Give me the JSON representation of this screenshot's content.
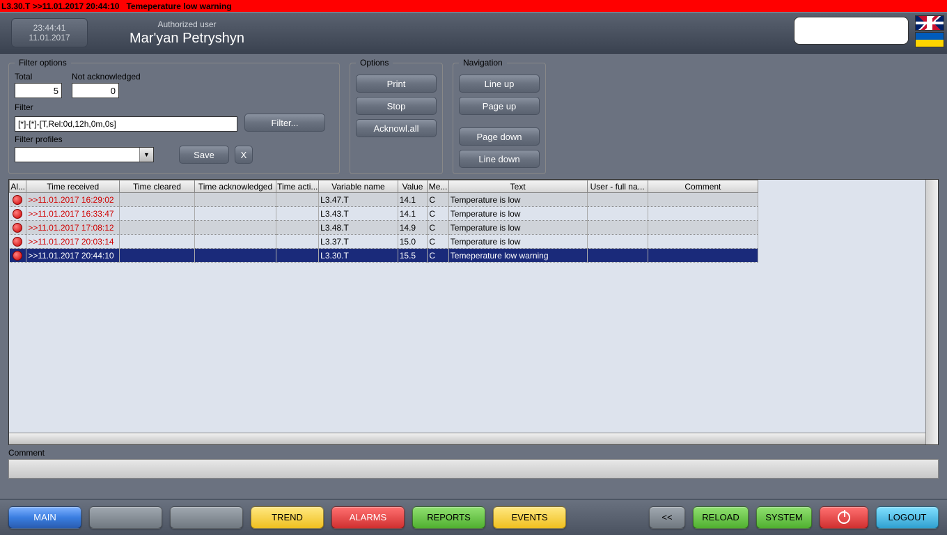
{
  "top_alarm": {
    "variable": "L3.30.T",
    "ts": ">>11.01.2017 20:44:10",
    "msg": "Temeperature low warning"
  },
  "clock": {
    "time": "23:44:41",
    "date": "11.01.2017"
  },
  "user": {
    "label": "Authorized user",
    "name": "Mar'yan Petryshyn"
  },
  "filter_options": {
    "legend": "Filter options",
    "total_label": "Total",
    "total": "5",
    "nack_label": "Not acknowledged",
    "nack": "0",
    "filter_label": "Filter",
    "filter_value": "[*]-[*]-[T,Rel:0d,12h,0m,0s]",
    "filter_btn": "Filter...",
    "profiles_label": "Filter profiles",
    "save_btn": "Save",
    "clear_btn": "X"
  },
  "options": {
    "legend": "Options",
    "print": "Print",
    "stop": "Stop",
    "ack": "Acknowl.all"
  },
  "navigation": {
    "legend": "Navigation",
    "lu": "Line up",
    "pu": "Page up",
    "pd": "Page down",
    "ld": "Line down"
  },
  "table": {
    "headers": {
      "al": "Al...",
      "tr": "Time received",
      "tc": "Time cleared",
      "ta": "Time acknowledged",
      "tact": "Time acti...",
      "vn": "Variable name",
      "val": "Value",
      "me": "Me...",
      "text": "Text",
      "user": "User - full na...",
      "cm": "Comment"
    },
    "rows": [
      {
        "tr": ">>11.01.2017 16:29:02",
        "vn": "L3.47.T",
        "val": "14.1",
        "me": "C",
        "text": "Temperature is low",
        "sel": false,
        "unack": true
      },
      {
        "tr": ">>11.01.2017 16:33:47",
        "vn": "L3.43.T",
        "val": "14.1",
        "me": "C",
        "text": "Temperature is low",
        "sel": false,
        "unack": true
      },
      {
        "tr": ">>11.01.2017 17:08:12",
        "vn": "L3.48.T",
        "val": "14.9",
        "me": "C",
        "text": "Temperature is low",
        "sel": false,
        "unack": true
      },
      {
        "tr": ">>11.01.2017 20:03:14",
        "vn": "L3.37.T",
        "val": "15.0",
        "me": "C",
        "text": "Temperature is low",
        "sel": false,
        "unack": true
      },
      {
        "tr": ">>11.01.2017 20:44:10",
        "vn": "L3.30.T",
        "val": "15.5",
        "me": "C",
        "text": "Temeperature low warning",
        "sel": true,
        "unack": false
      }
    ]
  },
  "comment": {
    "label": "Comment"
  },
  "footer": {
    "main": "MAIN",
    "trend": "TREND",
    "alarms": "ALARMS",
    "reports": "REPORTS",
    "events": "EVENTS",
    "back": "<<",
    "reload": "RELOAD",
    "system": "SYSTEM",
    "logout": "LOGOUT"
  }
}
